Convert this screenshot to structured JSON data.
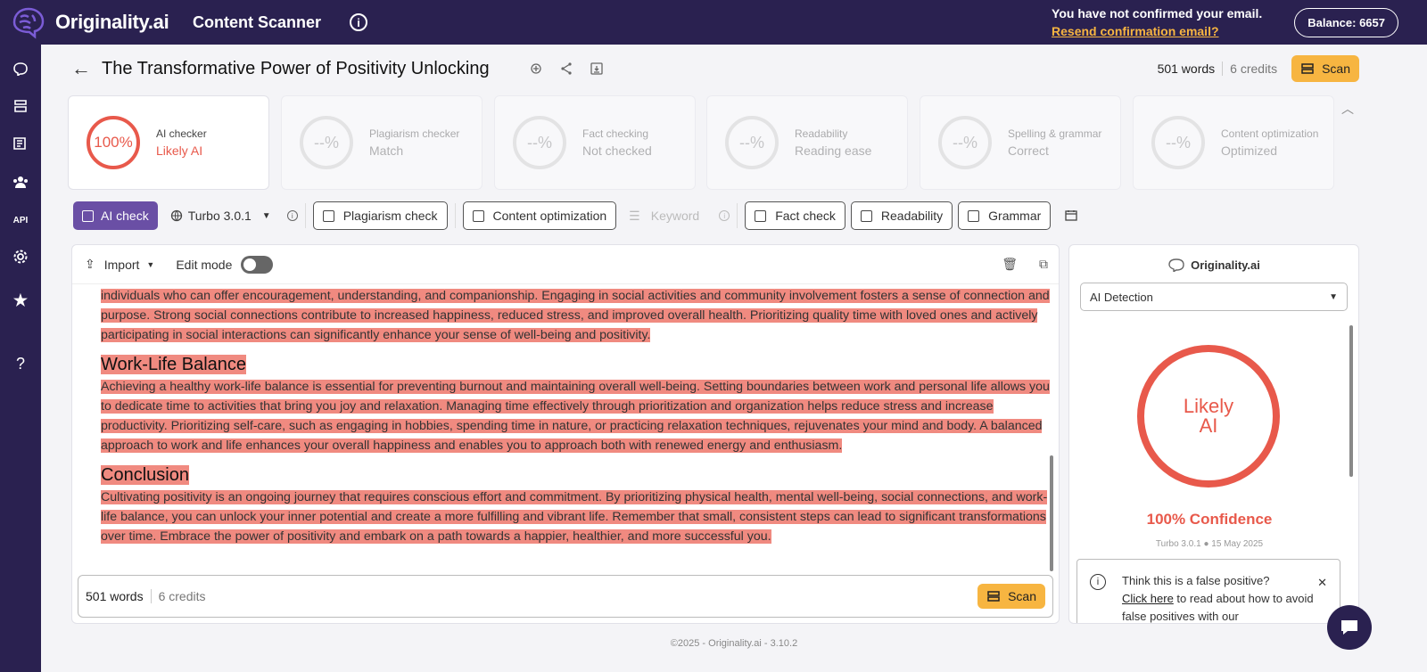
{
  "topbar": {
    "brand": "Originality.ai",
    "app_title": "Content Scanner",
    "email_notice": "You have not confirmed your email.",
    "resend_link": "Resend confirmation email?",
    "balance": "Balance: 6657"
  },
  "document": {
    "title": "The Transformative Power of Positivity Unlocking",
    "words": "501 words",
    "credits": "6 credits",
    "scan_label": "Scan"
  },
  "cards": [
    {
      "value": "100%",
      "label": "AI checker",
      "result": "Likely AI"
    },
    {
      "value": "--%",
      "label": "Plagiarism checker",
      "result": "Match"
    },
    {
      "value": "--%",
      "label": "Fact checking",
      "result": "Not checked"
    },
    {
      "value": "--%",
      "label": "Readability",
      "result": "Reading ease"
    },
    {
      "value": "--%",
      "label": "Spelling & grammar",
      "result": "Correct"
    },
    {
      "value": "--%",
      "label": "Content optimization",
      "result": "Optimized"
    }
  ],
  "toolbar": {
    "ai_check": "AI check",
    "model": "Turbo 3.0.1",
    "plagiarism": "Plagiarism check",
    "content_opt": "Content optimization",
    "keyword": "Keyword",
    "fact": "Fact check",
    "readability": "Readability",
    "grammar": "Grammar"
  },
  "editor": {
    "import": "Import",
    "edit_mode": "Edit mode",
    "para1": "individuals who can offer encouragement, understanding, and companionship.  Engaging in social activities and community involvement fosters a sense of connection and purpose.  Strong social connections contribute to increased happiness, reduced stress, and improved overall health.  Prioritizing quality time with loved ones and actively participating in social interactions can significantly enhance your sense of well-being and positivity.",
    "h2": "Work-Life Balance",
    "para2": "Achieving a healthy work-life balance is essential for preventing burnout and maintaining overall well-being.  Setting boundaries between work and personal life allows you to dedicate time to activities that bring you joy and relaxation.  Managing time effectively through prioritization and organization helps reduce stress and increase productivity.  Prioritizing self-care, such as engaging in hobbies, spending time in nature, or practicing relaxation techniques, rejuvenates your mind and body.  A balanced approach to work and life enhances your overall happiness and enables you to approach both with renewed energy and enthusiasm.",
    "h3": "Conclusion",
    "para3": "Cultivating positivity is an ongoing journey that requires conscious effort and commitment.  By prioritizing physical health, mental well-being, social connections, and work-life balance, you can unlock your inner potential and create a more fulfilling and vibrant life.  Remember that small, consistent steps can lead to significant transformations over time.  Embrace the power of positivity and embark on a path towards a happier, healthier, and more successful you.",
    "footer_words": "501 words",
    "footer_credits": "6 credits",
    "footer_scan": "Scan"
  },
  "result_panel": {
    "brand": "Originality.ai",
    "dropdown": "AI Detection",
    "ring_line1": "Likely",
    "ring_line2": "AI",
    "confidence": "100% Confidence",
    "meta": "Turbo 3.0.1 ● 15 May 2025",
    "fp_title": "Think this is a false positive?",
    "fp_link": "Click here",
    "fp_rest": " to read about how to avoid false positives with our"
  },
  "footer": "©2025 - Originality.ai - 3.10.2",
  "colors": {
    "nav": "#2a2150",
    "accent": "#6a4fa5",
    "ai_red": "#e8594b",
    "scan": "#f7b541"
  }
}
